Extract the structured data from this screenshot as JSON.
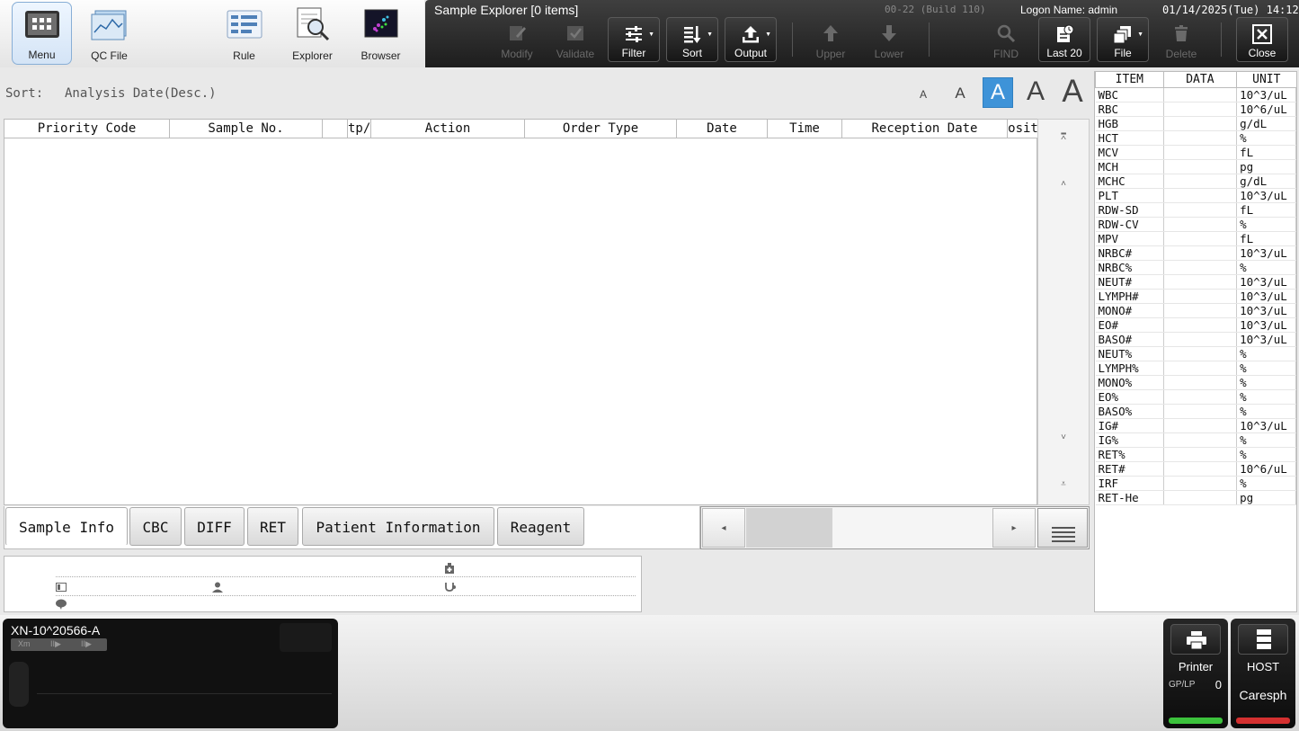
{
  "toolbar": {
    "menu": "Menu",
    "qc_file": "QC File",
    "rule": "Rule",
    "explorer": "Explorer",
    "browser": "Browser"
  },
  "command_bar": {
    "title": "Sample Explorer [0 items]",
    "build": "00-22 (Build 110)",
    "logon": "Logon Name: admin",
    "datetime": "01/14/2025(Tue) 14:12",
    "buttons": {
      "modify": "Modify",
      "validate": "Validate",
      "filter": "Filter",
      "sort": "Sort",
      "output": "Output",
      "upper": "Upper",
      "lower": "Lower",
      "find": "FIND",
      "last20": "Last 20",
      "file": "File",
      "delete": "Delete",
      "close": "Close"
    }
  },
  "sort": {
    "label": "Sort:",
    "value": "Analysis Date(Desc.)"
  },
  "font_size_buttons": [
    "A",
    "A",
    "A",
    "A",
    "A"
  ],
  "table": {
    "columns": [
      "Priority Code",
      "Sample No.",
      "",
      "tp/",
      "Action",
      "Order Type",
      "Date",
      "Time",
      "Reception Date",
      "osit"
    ],
    "rows": []
  },
  "tabs": [
    "Sample Info",
    "CBC",
    "DIFF",
    "RET",
    "Patient Information",
    "Reagent"
  ],
  "right_panel": {
    "headers": [
      "ITEM",
      "DATA",
      "UNIT"
    ],
    "rows": [
      {
        "item": "WBC",
        "data": "",
        "unit": "10^3/uL"
      },
      {
        "item": "RBC",
        "data": "",
        "unit": "10^6/uL"
      },
      {
        "item": "HGB",
        "data": "",
        "unit": "g/dL"
      },
      {
        "item": "HCT",
        "data": "",
        "unit": "%"
      },
      {
        "item": "MCV",
        "data": "",
        "unit": "fL"
      },
      {
        "item": "MCH",
        "data": "",
        "unit": "pg"
      },
      {
        "item": "MCHC",
        "data": "",
        "unit": "g/dL"
      },
      {
        "item": "PLT",
        "data": "",
        "unit": "10^3/uL"
      },
      {
        "item": "RDW-SD",
        "data": "",
        "unit": "fL"
      },
      {
        "item": "RDW-CV",
        "data": "",
        "unit": "%"
      },
      {
        "item": "MPV",
        "data": "",
        "unit": "fL"
      },
      {
        "item": "NRBC#",
        "data": "",
        "unit": "10^3/uL"
      },
      {
        "item": "NRBC%",
        "data": "",
        "unit": "%"
      },
      {
        "item": "NEUT#",
        "data": "",
        "unit": "10^3/uL"
      },
      {
        "item": "LYMPH#",
        "data": "",
        "unit": "10^3/uL"
      },
      {
        "item": "MONO#",
        "data": "",
        "unit": "10^3/uL"
      },
      {
        "item": "EO#",
        "data": "",
        "unit": "10^3/uL"
      },
      {
        "item": "BASO#",
        "data": "",
        "unit": "10^3/uL"
      },
      {
        "item": "NEUT%",
        "data": "",
        "unit": "%"
      },
      {
        "item": "LYMPH%",
        "data": "",
        "unit": "%"
      },
      {
        "item": "MONO%",
        "data": "",
        "unit": "%"
      },
      {
        "item": "EO%",
        "data": "",
        "unit": "%"
      },
      {
        "item": "BASO%",
        "data": "",
        "unit": "%"
      },
      {
        "item": "IG#",
        "data": "",
        "unit": "10^3/uL"
      },
      {
        "item": "IG%",
        "data": "",
        "unit": "%"
      },
      {
        "item": "RET%",
        "data": "",
        "unit": "%"
      },
      {
        "item": "RET#",
        "data": "",
        "unit": "10^6/uL"
      },
      {
        "item": "IRF",
        "data": "",
        "unit": "%"
      },
      {
        "item": "RET-He",
        "data": "",
        "unit": "pg"
      }
    ]
  },
  "analyzer": {
    "name": "XN-10^20566-A",
    "modes": [
      "Xm",
      "II▶",
      "II▶"
    ]
  },
  "printer": {
    "label": "Printer",
    "queue_label": "GP/LP",
    "queue_count": "0"
  },
  "host": {
    "label": "HOST",
    "name": "Caresph"
  },
  "colors": {
    "selected_blue": "#3e93d8",
    "printer_bar": "#3cc23c",
    "host_bar": "#d43030"
  }
}
